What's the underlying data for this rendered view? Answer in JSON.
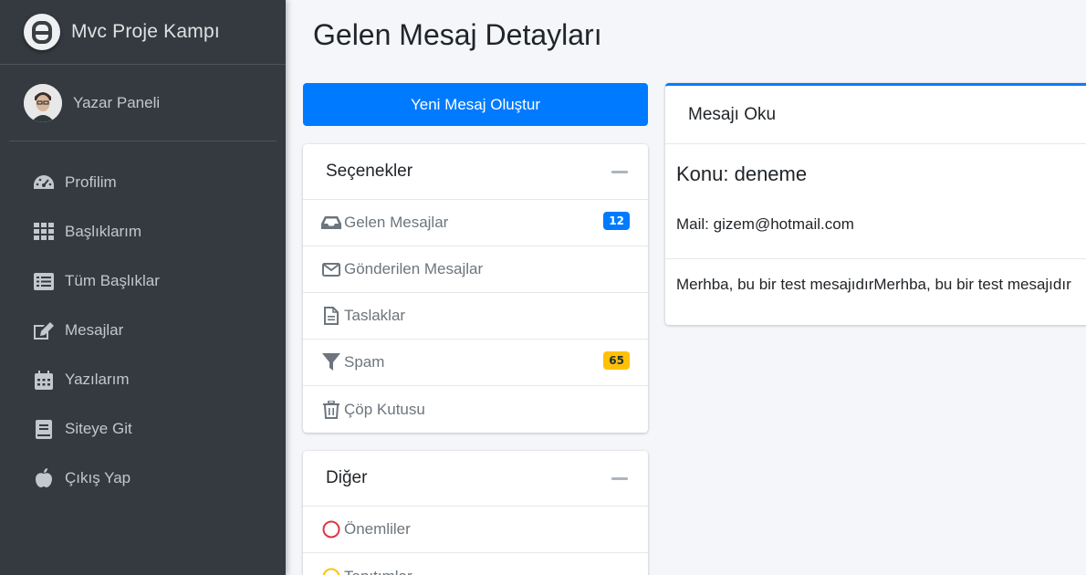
{
  "brand": {
    "title": "Mvc Proje Kampı",
    "logo_icon": "brand-logo-icon"
  },
  "user": {
    "name": "Yazar Paneli"
  },
  "nav": [
    {
      "label": "Profilim",
      "icon": "tachometer-icon"
    },
    {
      "label": "Başlıklarım",
      "icon": "grid-icon"
    },
    {
      "label": "Tüm Başlıklar",
      "icon": "list-icon"
    },
    {
      "label": "Mesajlar",
      "icon": "edit-icon"
    },
    {
      "label": "Yazılarım",
      "icon": "calendar-icon"
    },
    {
      "label": "Siteye Git",
      "icon": "book-icon"
    },
    {
      "label": "Çıkış Yap",
      "icon": "apple-icon"
    }
  ],
  "page": {
    "title": "Gelen Mesaj Detayları"
  },
  "new_message_button": "Yeni Mesaj Oluştur",
  "options_card": {
    "title": "Seçenekler",
    "items": [
      {
        "label": "Gelen Mesajlar",
        "icon": "inbox-icon",
        "badge": "12",
        "badge_color": "#007bff"
      },
      {
        "label": "Gönderilen Mesajlar",
        "icon": "envelope-icon"
      },
      {
        "label": "Taslaklar",
        "icon": "file-icon"
      },
      {
        "label": "Spam",
        "icon": "filter-icon",
        "badge": "65",
        "badge_color": "#ffc107"
      },
      {
        "label": "Çöp Kutusu",
        "icon": "trash-icon"
      }
    ]
  },
  "other_card": {
    "title": "Diğer",
    "items": [
      {
        "label": "Önemliler",
        "icon": "circle-icon",
        "color": "#dc3545"
      },
      {
        "label": "Tanıtımlar",
        "icon": "circle-icon",
        "color": "#ffc107"
      }
    ]
  },
  "message": {
    "header": "Mesajı Oku",
    "subject": "Konu: deneme",
    "mail": "Mail: gizem@hotmail.com",
    "body": "Merhba, bu bir test mesajıdırMerhba, bu bir test mesajıdır"
  },
  "colors": {
    "sidebar": "#343a40",
    "primary": "#007bff",
    "warning": "#ffc107",
    "danger": "#dc3545"
  }
}
